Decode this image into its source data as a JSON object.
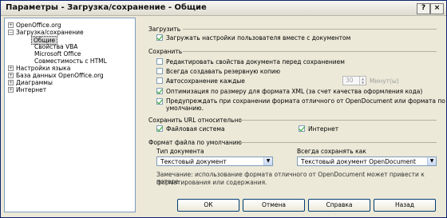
{
  "window": {
    "title": "Параметры - Загрузка/сохранение - Общие"
  },
  "tree": [
    {
      "label": "OpenOffice.org",
      "expand": "+"
    },
    {
      "label": "Загрузка/сохранение",
      "expand": "−"
    },
    {
      "label": "Общие",
      "selected": true
    },
    {
      "label": "Свойства VBA"
    },
    {
      "label": "Microsoft Office"
    },
    {
      "label": "Совместимость с HTML"
    },
    {
      "label": "Настройки языка",
      "expand": "+"
    },
    {
      "label": "База данных OpenOffice.org",
      "expand": "+"
    },
    {
      "label": "Диаграммы",
      "expand": "+"
    },
    {
      "label": "Интернет",
      "expand": "+"
    }
  ],
  "load": {
    "title": "Загрузить",
    "user_settings": "Загружать настройки пользователя вместе с документом"
  },
  "save": {
    "title": "Сохранить",
    "edit_properties": "Редактировать свойства документа перед сохранением",
    "backup": "Всегда создавать резервную копию",
    "autosave": "Автосохранение каждые",
    "autosave_value": "30",
    "autosave_unit": "Минут(ы)",
    "optimize_xml": "Оптимизация по размеру для формата XML (за счет качества оформления кода)",
    "warn_format": "Предупреждать при сохранении формата отличного от OpenDocument или формата по",
    "warn_format_2": "умолчанию."
  },
  "url": {
    "title": "Сохранить URL относительно",
    "filesystem": "Файловая система",
    "internet": "Интернет"
  },
  "default_format": {
    "title": "Формат файла по умолчанию",
    "doc_type_label": "Тип документа",
    "doc_type_value": "Текстовый документ",
    "always_save_label": "Всегда сохранять как",
    "always_save_value": "Текстовый документ OpenDocument",
    "note_1": "Замечание: использование формата отличного от OpenDocument может привести к потере",
    "note_2": "форматирования или содержания."
  },
  "buttons": {
    "ok": "ОК",
    "cancel": "Отмена",
    "help": "Справка",
    "back": "Назад"
  }
}
